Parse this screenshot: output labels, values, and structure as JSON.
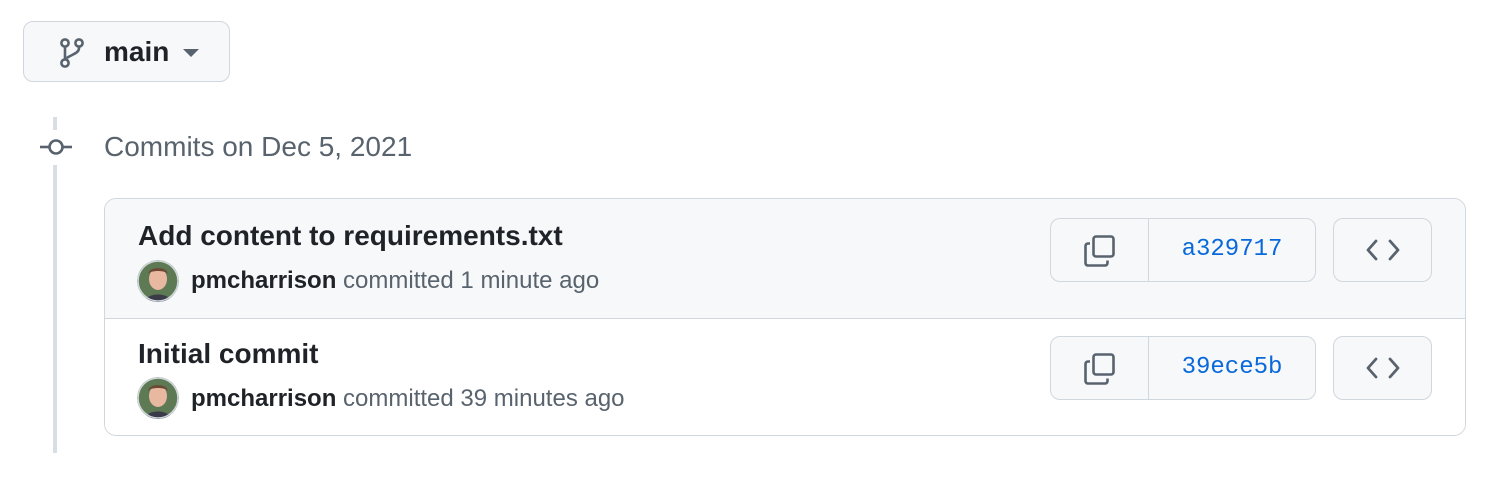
{
  "branch": {
    "name": "main",
    "icon": "git-branch-icon",
    "caret_icon": "triangle-down-icon"
  },
  "timeline": {
    "date_heading": "Commits on Dec 5, 2021",
    "node_icon": "git-commit-icon"
  },
  "commits": [
    {
      "title": "Add content to requirements.txt",
      "author": "pmcharrison",
      "action": "committed",
      "time": "1 minute ago",
      "sha": "a329717"
    },
    {
      "title": "Initial commit",
      "author": "pmcharrison",
      "action": "committed",
      "time": "39 minutes ago",
      "sha": "39ece5b"
    }
  ],
  "colors": {
    "link": "#0969da",
    "muted_text": "#59636e",
    "border": "#d0d7de",
    "button_bg": "#f6f8fa"
  }
}
